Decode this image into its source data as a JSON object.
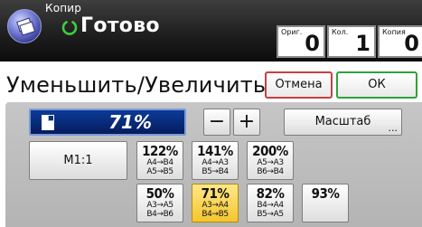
{
  "status": {
    "app_title": "Копир",
    "ready_text": "Готово",
    "counters": {
      "originals_label": "Ориг.",
      "originals_value": "0",
      "set_label": "Кол.",
      "set_value": "1",
      "copies_label": "Копия",
      "copies_value": "0"
    }
  },
  "header": {
    "title": "Уменьшить/Увеличить",
    "cancel_label": "Отмена",
    "ok_label": "ОК"
  },
  "ratio": {
    "value": "71%",
    "minus_label": "−",
    "plus_label": "+",
    "zoom_label": "Масштаб",
    "zoom_dots": "..."
  },
  "m11_label": "М1:1",
  "presets": [
    {
      "pct": "122%",
      "line1": "A4→B4",
      "line2": "A5→B5",
      "selected": false
    },
    {
      "pct": "141%",
      "line1": "A4→A3",
      "line2": "B5→B4",
      "selected": false
    },
    {
      "pct": "200%",
      "line1": "A5→A3",
      "line2": "B6→B4",
      "selected": false
    },
    {
      "pct": "50%",
      "line1": "A3→A5",
      "line2": "B4→B6",
      "selected": false
    },
    {
      "pct": "71%",
      "line1": "A3→A4",
      "line2": "B4→B5",
      "selected": true
    },
    {
      "pct": "82%",
      "line1": "B4→A4",
      "line2": "B5→A5",
      "selected": false
    },
    {
      "pct": "93%",
      "line1": "",
      "line2": "",
      "selected": false
    }
  ],
  "colors": {
    "selected_preset": "#f4c52e",
    "cancel_border": "#c24343",
    "ok_border": "#2fa23a",
    "ratio_display": "#0c3b97",
    "ready_icon": "#3ecf3e"
  }
}
